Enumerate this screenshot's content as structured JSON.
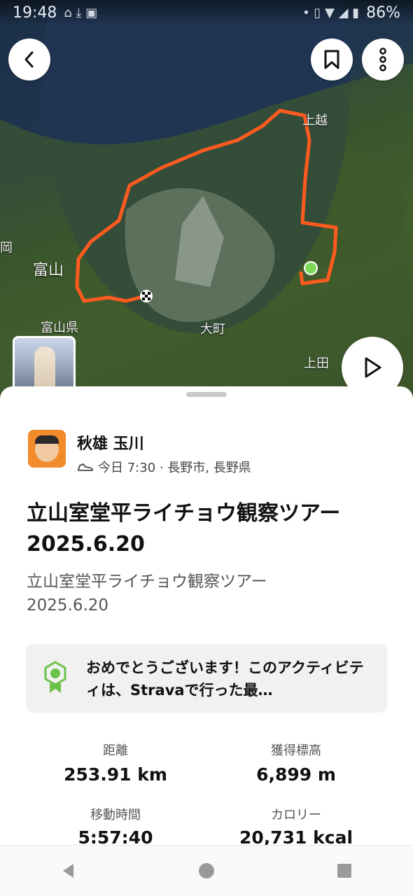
{
  "status_bar": {
    "time": "19:48",
    "battery": "86%"
  },
  "map": {
    "labels": {
      "joetsu": "上越",
      "toyama": "富山",
      "toyama_pref": "富山県",
      "omachi": "大町",
      "ueda": "上田",
      "oka": "岡"
    }
  },
  "icons": {
    "back": "chevron-left-icon",
    "bookmark": "bookmark-icon",
    "more": "more-vertical-icon",
    "play": "play-icon",
    "shoe": "shoe-icon",
    "badge": "achievement-badge-icon"
  },
  "colors": {
    "route": "#ff5a1f",
    "start": "#7ed957",
    "accent": "#fc4c02"
  },
  "athlete": {
    "name": "秋雄 玉川",
    "meta": "今日 7:30 · 長野市, 長野県"
  },
  "activity": {
    "title": "立山室堂平ライチョウ観察ツアー 2025.6.20",
    "description": "立山室堂平ライチョウ観察ツアー\n2025.6.20",
    "achievement": "おめでとうございます！このアクティビティは、Stravaで行った最…"
  },
  "stats": [
    {
      "label": "距離",
      "value": "253.91 km"
    },
    {
      "label": "獲得標高",
      "value": "6,899 m"
    },
    {
      "label": "移動時間",
      "value": "5:57:40"
    },
    {
      "label": "カロリー",
      "value": "20,731 kcal"
    }
  ]
}
